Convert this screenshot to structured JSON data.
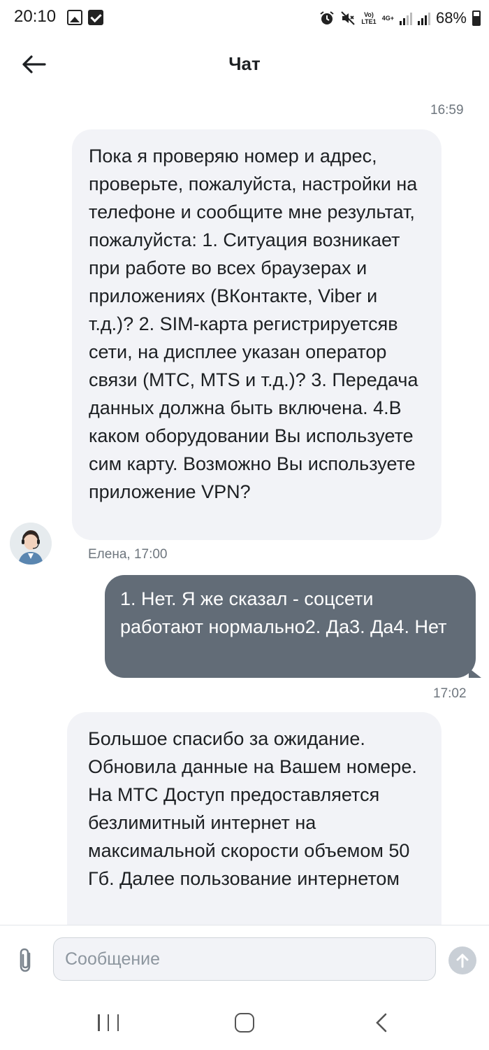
{
  "status_bar": {
    "time": "20:10",
    "volte": "Vo)\nLTE1",
    "network": "4G+",
    "battery": "68%"
  },
  "header": {
    "title": "Чат"
  },
  "chat": {
    "timestamp_1": "16:59",
    "message_1": "Пока я проверяю номер и адрес, проверьте, пожалуйста, настройки на телефоне и сообщите мне результат, пожалуйста: 1. Ситуация возникает при работе во всех браузерах и приложениях (ВКонтакте, Viber и т.д.)? 2. SIM-карта регистрируетсяв сети, на дисплее указан оператор связи (МТС, MTS и т.д.)? 3. Передача данных должна быть включена. 4.В каком оборудовании Вы используете сим карту. Возможно Вы используете приложение VPN?",
    "sender_1": "Елена, 17:00",
    "message_2": "1. Нет. Я же сказал - соцсети работают нормально2. Да3. Да4. Нет",
    "timestamp_2": "17:02",
    "message_3": "Большое спасибо за ожидание. Обновила данные на Вашем номере. На МТС Доступ предоставляется безлимитный интернет на максимальной скорости объемом 50 Гб. Далее пользование интернетом"
  },
  "composer": {
    "placeholder": "Сообщение"
  }
}
